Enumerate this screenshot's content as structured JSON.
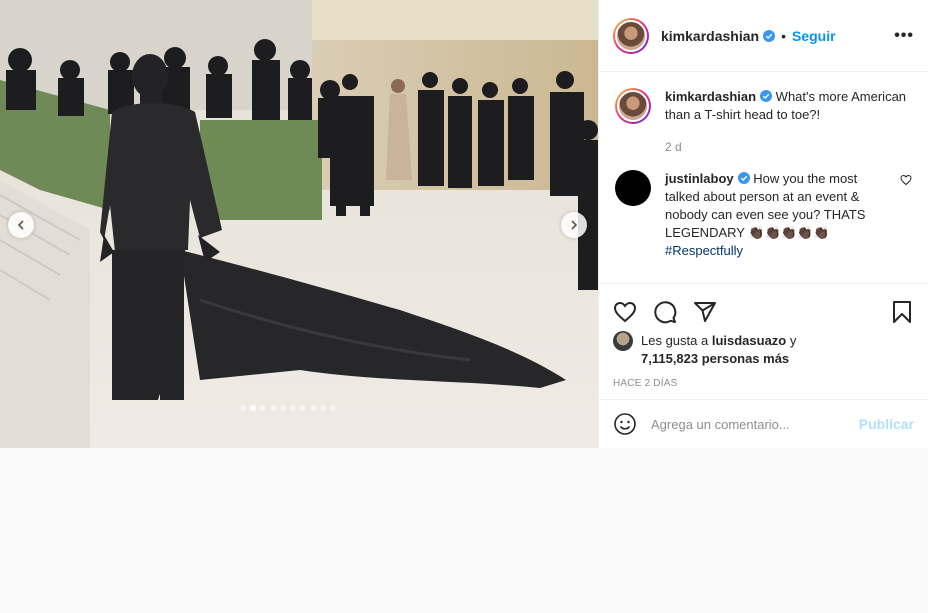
{
  "header": {
    "username": "kimkardashian",
    "separator": "•",
    "follow_label": "Seguir",
    "more_label": "•••"
  },
  "caption": {
    "username": "kimkardashian",
    "text": "What's more American than a T-shirt head to toe?!",
    "time": "2 d"
  },
  "comments": [
    {
      "username": "justinlaboy",
      "text": "How you the most talked about person at an event & nobody can even see you? THATS LEGENDARY 👏🏿👏🏿👏🏿👏🏿👏🏿",
      "hashtag": "#Respectfully"
    }
  ],
  "likes": {
    "prefix": "Les gusta a",
    "user": "luisdasuazo",
    "conj": "y",
    "count": "7,115,823 personas más"
  },
  "posted": "HACE 2 DÍAS",
  "add_comment": {
    "placeholder": "Agrega un comentario...",
    "publish_label": "Publicar"
  },
  "carousel": {
    "active_index": 0,
    "total": 10
  },
  "colors": {
    "accent": "#0095f6",
    "publish_disabled": "#b2dffc",
    "verified": "#3897f0"
  }
}
